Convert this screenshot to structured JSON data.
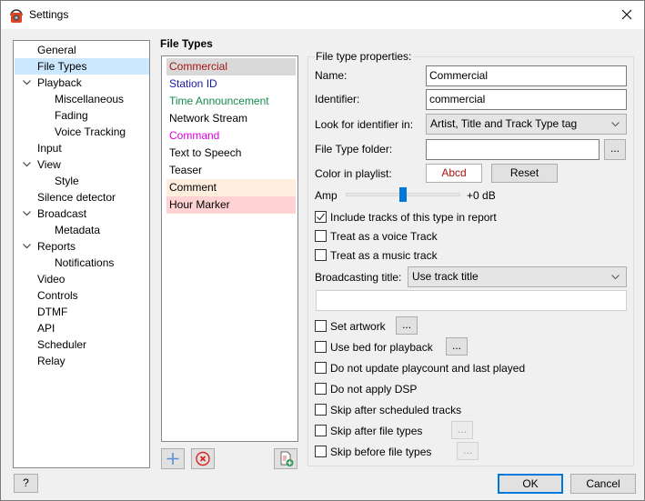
{
  "window": {
    "title": "Settings",
    "app_icon": "headphones-app-icon",
    "close_icon": "close-icon"
  },
  "sidebar": {
    "items": [
      {
        "label": "General",
        "level": 0,
        "expanded": null,
        "selected": false
      },
      {
        "label": "File Types",
        "level": 0,
        "expanded": null,
        "selected": true
      },
      {
        "label": "Playback",
        "level": 0,
        "expanded": true,
        "selected": false
      },
      {
        "label": "Miscellaneous",
        "level": 1,
        "expanded": null,
        "selected": false
      },
      {
        "label": "Fading",
        "level": 1,
        "expanded": null,
        "selected": false
      },
      {
        "label": "Voice Tracking",
        "level": 1,
        "expanded": null,
        "selected": false
      },
      {
        "label": "Input",
        "level": 0,
        "expanded": null,
        "selected": false
      },
      {
        "label": "View",
        "level": 0,
        "expanded": true,
        "selected": false
      },
      {
        "label": "Style",
        "level": 1,
        "expanded": null,
        "selected": false
      },
      {
        "label": "Silence detector",
        "level": 0,
        "expanded": null,
        "selected": false
      },
      {
        "label": "Broadcast",
        "level": 0,
        "expanded": true,
        "selected": false
      },
      {
        "label": "Metadata",
        "level": 1,
        "expanded": null,
        "selected": false
      },
      {
        "label": "Reports",
        "level": 0,
        "expanded": true,
        "selected": false
      },
      {
        "label": "Notifications",
        "level": 1,
        "expanded": null,
        "selected": false
      },
      {
        "label": "Video",
        "level": 0,
        "expanded": null,
        "selected": false
      },
      {
        "label": "Controls",
        "level": 0,
        "expanded": null,
        "selected": false
      },
      {
        "label": "DTMF",
        "level": 0,
        "expanded": null,
        "selected": false
      },
      {
        "label": "API",
        "level": 0,
        "expanded": null,
        "selected": false
      },
      {
        "label": "Scheduler",
        "level": 0,
        "expanded": null,
        "selected": false
      },
      {
        "label": "Relay",
        "level": 0,
        "expanded": null,
        "selected": false
      }
    ]
  },
  "file_types": {
    "heading": "File Types",
    "items": [
      {
        "label": "Commercial",
        "color": "#a31515",
        "bg": "#d9d9d9",
        "selected": true
      },
      {
        "label": "Station ID",
        "color": "#1a1aa6",
        "bg": "#ffffff",
        "selected": false
      },
      {
        "label": "Time Announcement",
        "color": "#168a4a",
        "bg": "#ffffff",
        "selected": false
      },
      {
        "label": "Network Stream",
        "color": "#000000",
        "bg": "#ffffff",
        "selected": false
      },
      {
        "label": "Command",
        "color": "#e000e0",
        "bg": "#ffffff",
        "selected": false
      },
      {
        "label": "Text to Speech",
        "color": "#000000",
        "bg": "#ffffff",
        "selected": false
      },
      {
        "label": "Teaser",
        "color": "#000000",
        "bg": "#ffffff",
        "selected": false
      },
      {
        "label": "Comment",
        "color": "#000000",
        "bg": "#ffeede",
        "selected": false
      },
      {
        "label": "Hour Marker",
        "color": "#000000",
        "bg": "#ffd3d3",
        "selected": false
      }
    ],
    "buttons": {
      "add": "add-icon",
      "remove": "remove-icon",
      "new_from_file": "new-file-icon"
    }
  },
  "properties": {
    "group_label": "File type properties:",
    "name_label": "Name:",
    "name_value": "Commercial",
    "identifier_label": "Identifier:",
    "identifier_value": "commercial",
    "look_for_label": "Look for identifier in:",
    "look_for_value": "Artist, Title and Track Type tag",
    "folder_label": "File Type folder:",
    "folder_value": "",
    "browse_label": "...",
    "color_label": "Color in playlist:",
    "color_sample": "Abcd",
    "color_sample_color": "#a31515",
    "reset_label": "Reset",
    "amp_label": "Amp",
    "amp_value": "+0 dB",
    "amp_slider_fraction": 0.5,
    "checkboxes_top": [
      {
        "label": "Include tracks of this type in report",
        "checked": true
      },
      {
        "label": "Treat as a voice Track",
        "checked": false
      },
      {
        "label": "Treat as a music track",
        "checked": false
      }
    ],
    "broadcasting_label": "Broadcasting title:",
    "broadcasting_value": "Use track title",
    "broadcasting_custom": "",
    "checkboxes_bottom": [
      {
        "label": "Set artwork",
        "checked": false,
        "button": "...",
        "button_enabled": true
      },
      {
        "label": "Use bed for playback",
        "checked": false,
        "button": "...",
        "button_enabled": true
      },
      {
        "label": "Do not update playcount and last played",
        "checked": false
      },
      {
        "label": "Do not apply DSP",
        "checked": false
      },
      {
        "label": "Skip after scheduled tracks",
        "checked": false
      },
      {
        "label": "Skip after file types",
        "checked": false,
        "button": "...",
        "button_enabled": false
      },
      {
        "label": "Skip before file types",
        "checked": false,
        "button": "...",
        "button_enabled": false
      }
    ]
  },
  "footer": {
    "help_label": "?",
    "ok_label": "OK",
    "cancel_label": "Cancel"
  }
}
